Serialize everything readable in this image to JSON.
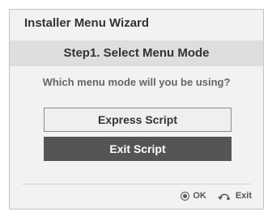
{
  "window": {
    "title": "Installer Menu Wizard"
  },
  "step": {
    "label": "Step1. Select Menu Mode"
  },
  "question": "Which menu mode will you be using?",
  "options": [
    {
      "label": "Express Script",
      "state": "normal"
    },
    {
      "label": "Exit Script",
      "state": "highlighted"
    }
  ],
  "footer": {
    "ok_label": "OK",
    "exit_label": "Exit",
    "ok_icon": "ok-circle-icon",
    "exit_icon": "back-return-icon"
  },
  "colors": {
    "dialog_bg": "#f2f2f2",
    "step_bar_bg": "#dedede",
    "highlight_bg": "#555555",
    "text": "#333333"
  }
}
